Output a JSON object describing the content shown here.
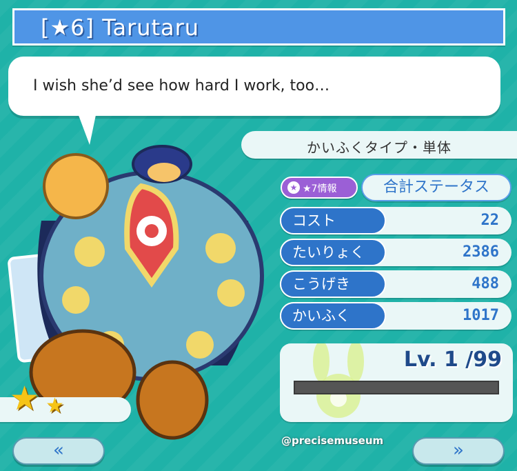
{
  "header": {
    "title": "[★6] Tarutaru"
  },
  "dialogue": {
    "text": "I wish she’d see how hard I work, too…"
  },
  "card": {
    "type_label": "かいふくタイプ・単体",
    "info_button": {
      "icon": "★",
      "label": "★7情報"
    },
    "summary_button": "合計ステータス",
    "stats": [
      {
        "label": "コスト",
        "value": "22"
      },
      {
        "label": "たいりょく",
        "value": "2386"
      },
      {
        "label": "こうげき",
        "value": "488"
      },
      {
        "label": "かいふく",
        "value": "1017"
      }
    ],
    "level": {
      "text": "Lv. 1 /99",
      "progress": 0
    }
  },
  "rarity": {
    "big_star": "★",
    "small_star": "★"
  },
  "nav": {
    "prev": "«",
    "next": "»"
  },
  "watermark": "@precisemuseum",
  "colors": {
    "background": "#1fb2a8",
    "accent": "#2e74c9",
    "title": "#4f95e6"
  }
}
